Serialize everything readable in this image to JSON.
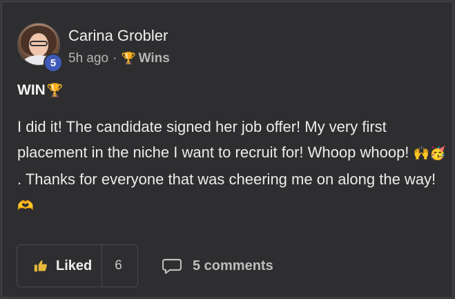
{
  "post": {
    "author": "Carina Grobler",
    "level": "5",
    "time_ago": "5h ago",
    "separator": "·",
    "category": "Wins",
    "title": "WIN",
    "body_part1": "I did it! The candidate signed her job offer! My very first placement in the niche I want to recruit for! Whoop whoop! ",
    "body_emoji1": "🙌🥳",
    "body_part2": " . Thanks for everyone that was cheering me on along the way! ",
    "body_emoji2": "🫶",
    "trophy": "🏆"
  },
  "actions": {
    "like_label": "Liked",
    "like_count": "6",
    "comments_label": "5 comments"
  },
  "colors": {
    "background": "#2e2e30",
    "level_badge": "#3f5ab8",
    "trophy": "#d4a63a"
  }
}
